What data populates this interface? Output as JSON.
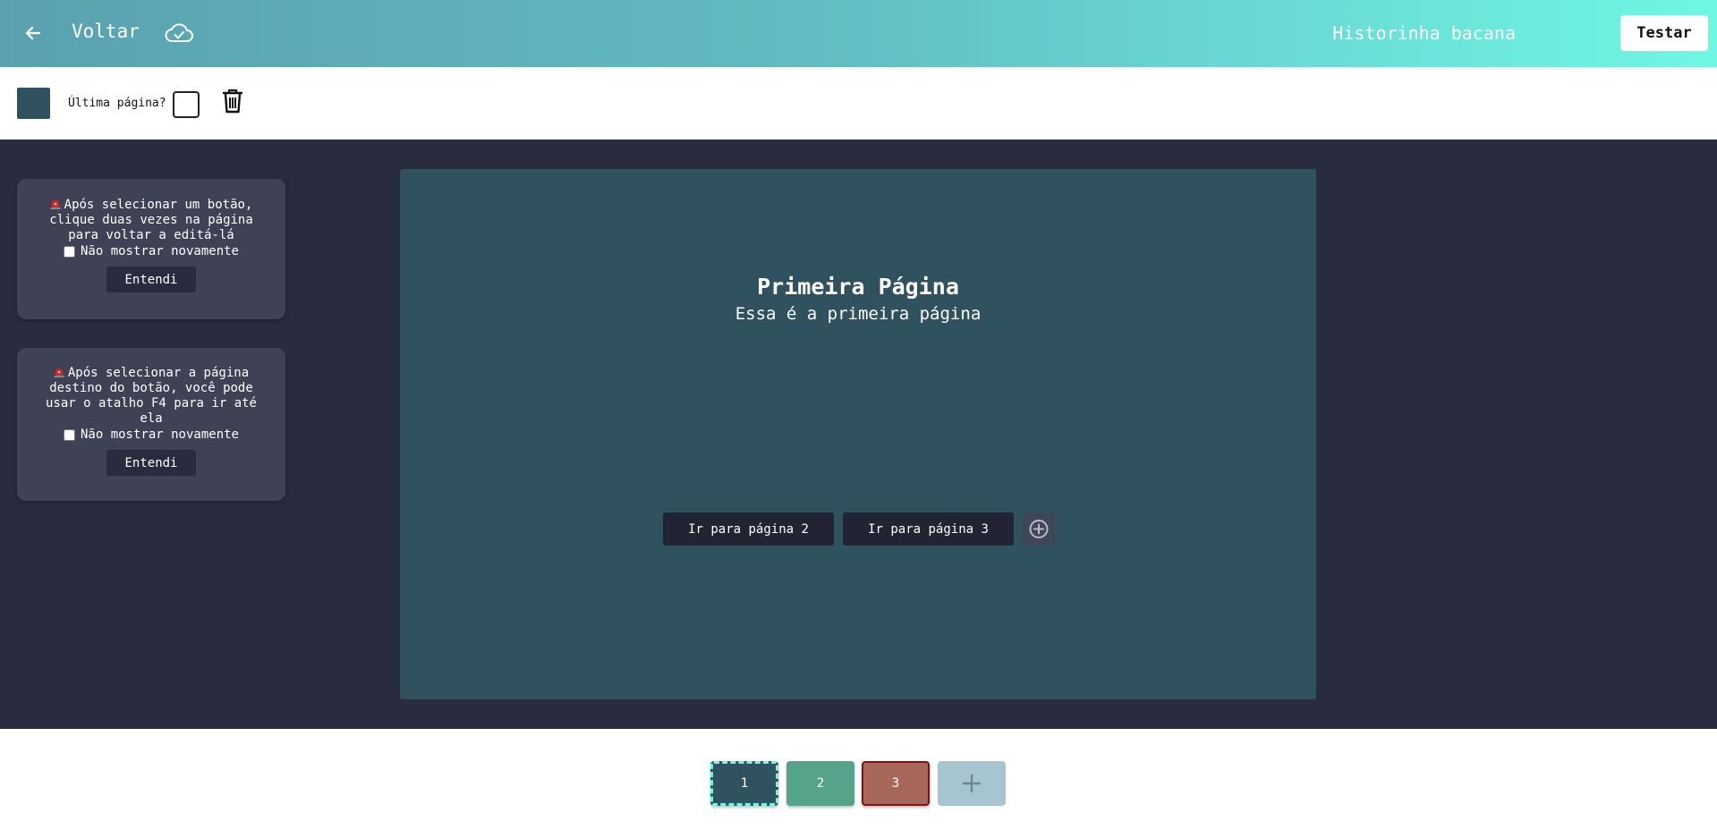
{
  "header": {
    "back_label": "Voltar",
    "story_title": "Historinha bacana",
    "test_button": "Testar",
    "icons": [
      "arrow-left-icon",
      "cloud-check-icon"
    ]
  },
  "toolbar": {
    "page_color": "#2f525e",
    "last_page_label": "Última página?",
    "last_page_checked": false,
    "icons": [
      "trash-icon"
    ]
  },
  "tips": [
    {
      "text": "Após selecionar um botão,\nclique duas vezes na página\npara voltar a editá-lá",
      "dont_show_label": "Não mostrar novamente",
      "ok_label": "Entendi",
      "icon": "siren-icon"
    },
    {
      "text": "Após selecionar a página\ndestino do botão, você pode\nusar o atalho F4 para ir até\nela",
      "dont_show_label": "Não mostrar novamente",
      "ok_label": "Entendi",
      "icon": "siren-icon"
    }
  ],
  "page": {
    "title": "Primeira Página",
    "subtitle": "Essa é a primeira página",
    "background": "#2f525e",
    "choices": [
      {
        "label": "Ir para página 2"
      },
      {
        "label": "Ir para página 3"
      }
    ]
  },
  "pages_bar": {
    "pages": [
      {
        "label": "1",
        "color": "#2f525e",
        "selected": true
      },
      {
        "label": "2",
        "color": "#56a38c",
        "selected": false
      },
      {
        "label": "3",
        "color": "#a7675a",
        "selected": false
      }
    ],
    "add_icon": "plus-icon"
  },
  "colors": {
    "header_gradient_start": "#5aa1b0",
    "header_gradient_end": "#6ff7e3",
    "workspace": "#292b3e",
    "tip_card": "#3f4155"
  }
}
